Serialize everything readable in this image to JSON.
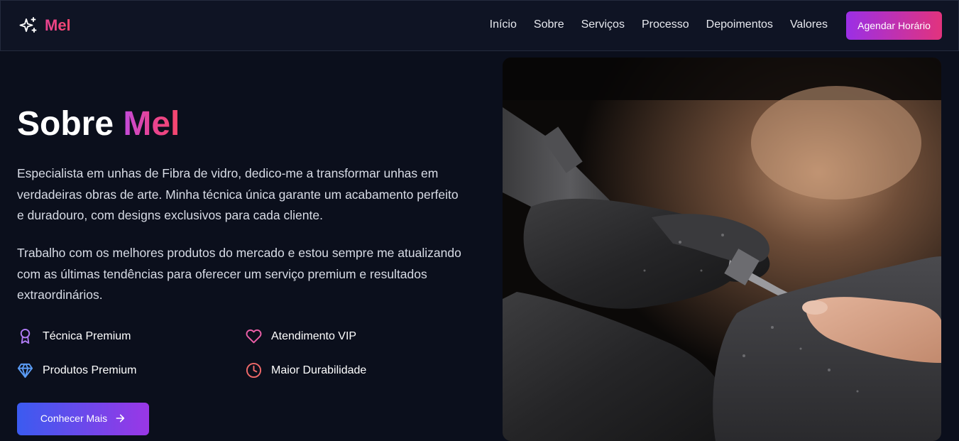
{
  "brand": {
    "name": "Mel",
    "icon": "sparkles-icon"
  },
  "nav": {
    "links": [
      "Início",
      "Sobre",
      "Serviços",
      "Processo",
      "Depoimentos",
      "Valores"
    ],
    "cta_label": "Agendar Horário"
  },
  "about": {
    "title_prefix": "Sobre",
    "title_accent": "Mel",
    "paragraph_1": "Especialista em unhas de Fibra de vidro, dedico-me a transformar unhas em verdadeiras obras de arte. Minha técnica única garante um acabamento perfeito e duradouro, com designs exclusivos para cada cliente.",
    "paragraph_2": "Trabalho com os melhores produtos do mercado e estou sempre me atualizando com as últimas tendências para oferecer um serviço premium e resultados extraordinários.",
    "features": [
      {
        "label": "Técnica Premium",
        "icon": "award-icon",
        "color": "#b07cf5"
      },
      {
        "label": "Atendimento VIP",
        "icon": "heart-icon",
        "color": "#ec5fa8"
      },
      {
        "label": "Produtos Premium",
        "icon": "diamond-icon",
        "color": "#5b9cf5"
      },
      {
        "label": "Maior Durabilidade",
        "icon": "clock-icon",
        "color": "#f26a6a"
      }
    ],
    "button_label": "Conhecer Mais",
    "button_icon": "arrow-right-icon"
  },
  "photo": {
    "subject": "manicure-drill-photo"
  },
  "colors": {
    "background": "#0b0f1c",
    "navbar": "#0f1424",
    "brand_gradient": [
      "#e84393",
      "#f5476c"
    ],
    "cta_gradient": [
      "#9b2fe6",
      "#e2337d"
    ],
    "button_gradient": [
      "#3b5bf0",
      "#9a37e6"
    ]
  }
}
